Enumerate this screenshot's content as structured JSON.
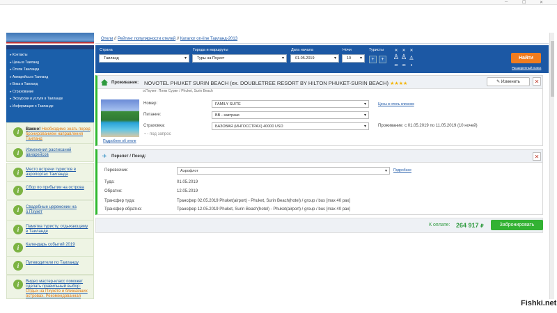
{
  "browser": {
    "min": "─",
    "max": "☐",
    "close": "✕"
  },
  "left_menu": [
    "Контакты",
    "Цены в Таиланд",
    "Отели Таиланда",
    "Авиарейсы в Таиланд",
    "Виза в Таиланд",
    "Страхование",
    "Экскурсии и услуги в Таиланде",
    "Информация о Таиланде"
  ],
  "info_blocks": [
    {
      "bold": "Важно!",
      "text": " Необходимо знать перед бронированием направления Таиланд"
    },
    {
      "text": "Изменения расписаний авиарейсов"
    },
    {
      "text": "Место встречи туристов в аэропортах Таиланда"
    },
    {
      "text": "Сбор по прибытии на острова"
    },
    {
      "text": "Свадебные церемонии на о.Пхукет"
    },
    {
      "text": "Памятка туристу, отдыхающему в Таиланде"
    },
    {
      "text": "Календарь событий 2019"
    },
    {
      "text": "Путеводители по Таиланду"
    },
    {
      "text": "Видео мастер-класс поможет сделать правильный выбор:",
      "orange": " Отдых на Пхукете и ближайших островах. Рекомендованная"
    }
  ],
  "breadcrumb": [
    "Отели",
    "Рейтинг популярности отелей",
    "Каталог on-line Таиланд-2013"
  ],
  "search": {
    "country_label": "Страна",
    "country": "Таиланд",
    "city_label": "Города и маршруты",
    "city": "Туры на Пхукет",
    "date_label": "Дата начала",
    "date": "01.05.2019",
    "nights_label": "Ночи",
    "nights": "10",
    "tourists_label": "Туристы",
    "ages": [
      "30",
      "30",
      "5"
    ],
    "find": "Найти",
    "extended": "Расширенный поиск"
  },
  "hotel": {
    "kind": "Проживание:",
    "name": "NOVOTEL PHUKET SURIN BEACH (ex. DOUBLETREE RESORT BY HILTON PHUKET-SURIN BEACH)",
    "stars": "★★★★",
    "location": "о.Пхукет: Пляж Сурин / Phuket, Surin Beach",
    "change": "✎ Изменить",
    "room_label": "Номер:",
    "room": "FAMILY SUITE",
    "meal_label": "Питание:",
    "meal": "BB - завтраки",
    "ins_label": "Страховка:",
    "ins": "БАЗОВАЯ (ИНГОССТРАХ) 40000 USD",
    "request": "- под запрос",
    "more": "Подробнее об отеле",
    "prices_link": "Цены в отель списком",
    "stay": "Проживание: с 01.05.2019 по 11.05.2019 (10 ночей)"
  },
  "flight": {
    "kind": "Перелет / Поезд:",
    "carrier_label": "Перевозчик:",
    "carrier": "Аэрофлот",
    "more": "Подробнее",
    "there_label": "Туда:",
    "there": "01.05.2019",
    "back_label": "Обратно:",
    "back": "12.05.2019",
    "tr_there_label": "Трансфер туда:",
    "tr_there": "Трансфер 02.05.2019 Phuket(airport) - Phuket, Surin Beach(hotel) / group / bus [max 40 pax]",
    "tr_back_label": "Трансфер обратно:",
    "tr_back": "Трансфер 12.05.2019 Phuket, Surin Beach(hotel) - Phuket(airport) / group / bus [max 40 pax]"
  },
  "total": {
    "label": "К оплате:",
    "price": "264 917",
    "currency": "₽",
    "book": "Забронировать"
  },
  "watermark": "Fishki.net",
  "colors": {
    "header_blue": "#1c58a4",
    "find_orange": "#f07c1e",
    "book_green": "#33b233",
    "accent_green": "#2eb82e"
  }
}
